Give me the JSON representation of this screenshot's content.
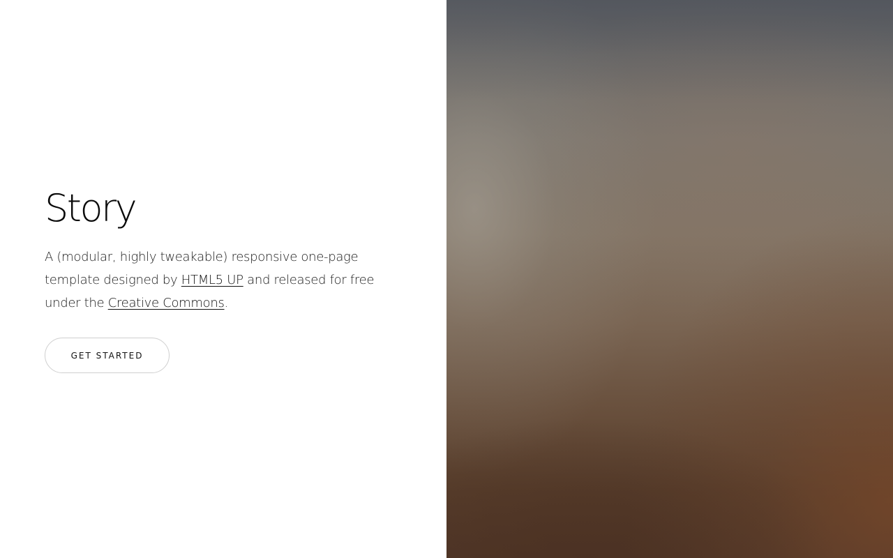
{
  "banner": {
    "title": "Story",
    "description_start": "A (modular, highly tweakable) responsive one-page template designed by ",
    "link_html5up": "HTML5 UP",
    "description_middle": " and released for free under the ",
    "link_creative_commons": "Creative Commons",
    "description_end": ".",
    "cta_label": "Get Started"
  },
  "image": {
    "description": "blurred-background-photo"
  }
}
